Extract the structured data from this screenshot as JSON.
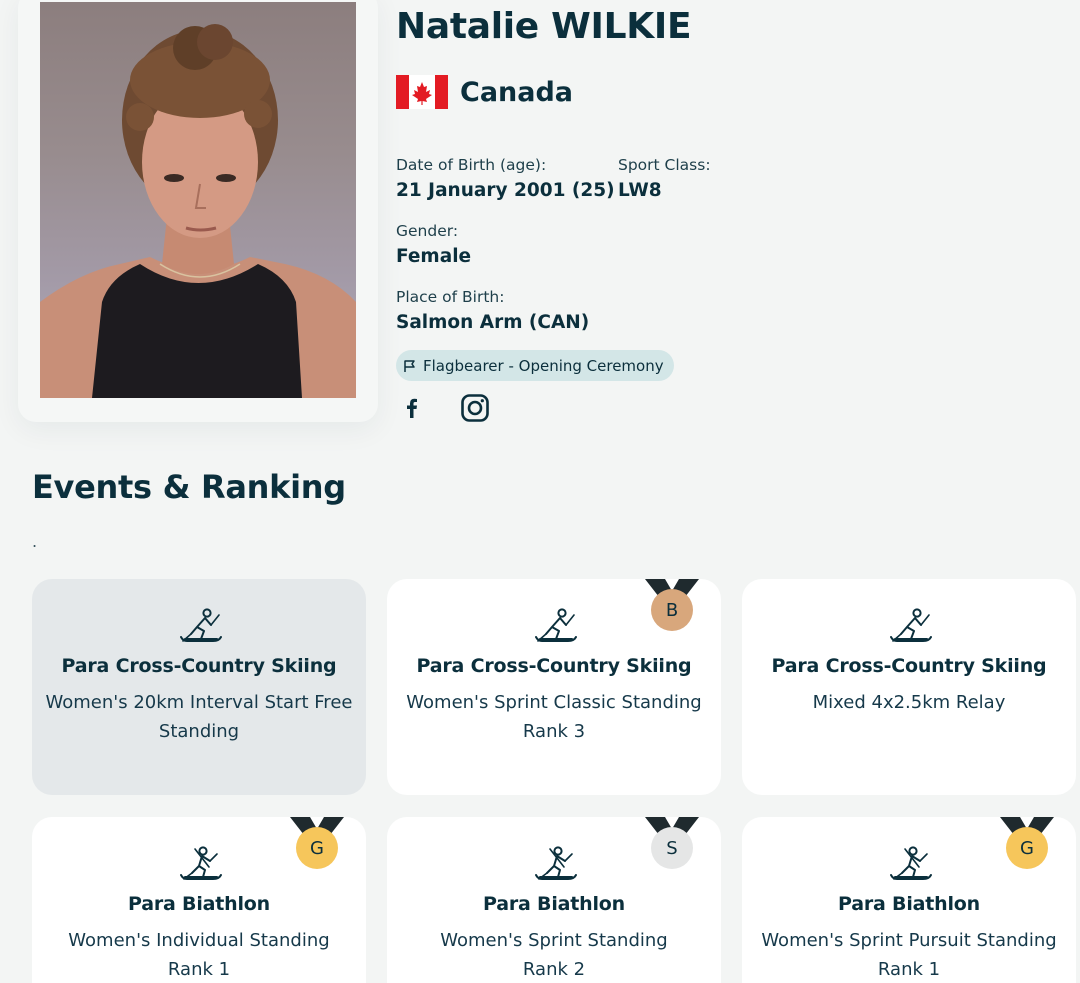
{
  "athlete": {
    "name": "Natalie WILKIE",
    "country": "Canada",
    "photo_icon": "athlete-portrait"
  },
  "fields": {
    "dob_label": "Date of Birth (age):",
    "dob_value": "21 January 2001 (25)",
    "sport_class_label": "Sport Class:",
    "sport_class_value": "LW8",
    "gender_label": "Gender:",
    "gender_value": "Female",
    "pob_label": "Place of Birth:",
    "pob_value": "Salmon Arm (CAN)"
  },
  "badge": {
    "label": "Flagbearer - Opening Ceremony",
    "icon": "flag-outline-icon",
    "color": "#d3e6e7"
  },
  "social": {
    "icons": [
      "facebook-icon",
      "instagram-icon"
    ]
  },
  "events_section": {
    "title": "Events & Ranking",
    "dot": "."
  },
  "medal_colors": {
    "G": "#f6c65b",
    "S": "#e5e6e6",
    "B": "#d8a77c"
  },
  "events": [
    {
      "sport": "Para Cross-Country Skiing",
      "event": "Women's 20km Interval Start Free Standing",
      "rank": "",
      "medal": "",
      "icon": "cross-country-skiing-icon"
    },
    {
      "sport": "Para Cross-Country Skiing",
      "event": "Women's Sprint Classic Standing",
      "rank": "Rank 3",
      "medal": "B",
      "icon": "cross-country-skiing-icon"
    },
    {
      "sport": "Para Cross-Country Skiing",
      "event": "Mixed 4x2.5km Relay",
      "rank": "",
      "medal": "",
      "icon": "cross-country-skiing-icon"
    },
    {
      "sport": "Para Biathlon",
      "event": "Women's Individual Standing",
      "rank": "Rank 1",
      "medal": "G",
      "icon": "biathlon-icon"
    },
    {
      "sport": "Para Biathlon",
      "event": "Women's Sprint Standing",
      "rank": "Rank 2",
      "medal": "S",
      "icon": "biathlon-icon"
    },
    {
      "sport": "Para Biathlon",
      "event": "Women's Sprint Pursuit Standing",
      "rank": "Rank 1",
      "medal": "G",
      "icon": "biathlon-icon"
    }
  ]
}
